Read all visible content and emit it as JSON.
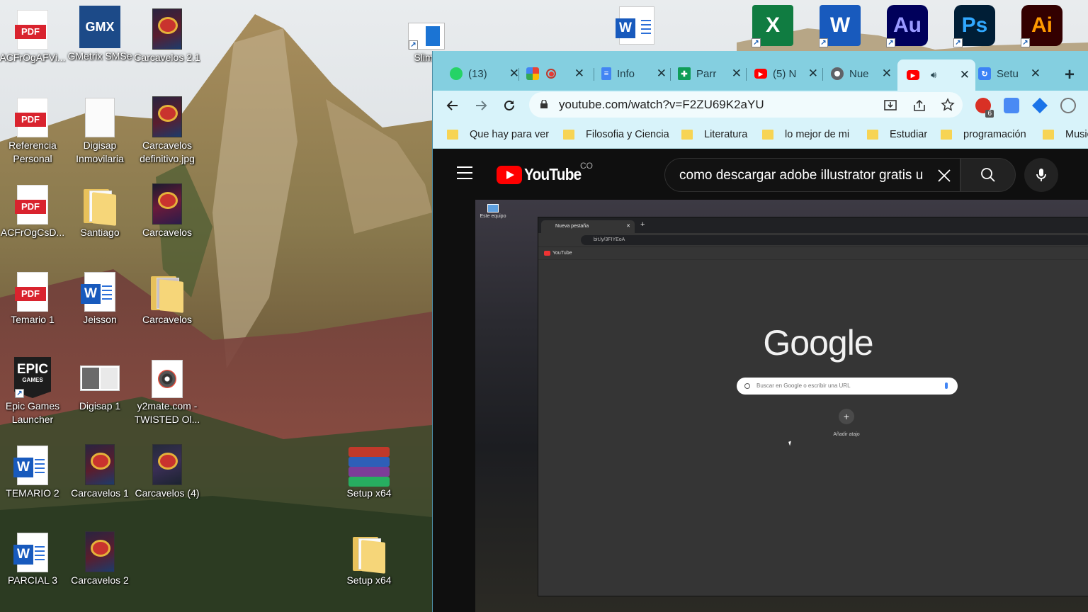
{
  "desktop": {
    "icons": [
      {
        "label": "ACFrOgAFVi...",
        "icon": "pdf-file-icon"
      },
      {
        "label": "GMetrix SMSe",
        "icon": "gmx-app-icon",
        "badge": "GMX"
      },
      {
        "label": "Carcavelos 2.1",
        "icon": "poster-image-icon"
      },
      {
        "label": "Slime",
        "icon": "document-shortcut-icon"
      },
      {
        "label": "Referencia Personal",
        "icon": "pdf-file-icon"
      },
      {
        "label": "Digisap Inmovilaria",
        "icon": "blank-document-icon"
      },
      {
        "label": "Carcavelos definitivo.jpg",
        "icon": "poster-image-icon"
      },
      {
        "label": "ACFrOgCsD...",
        "icon": "pdf-file-icon"
      },
      {
        "label": "Santiago",
        "icon": "folder-icon"
      },
      {
        "label": "Carcavelos",
        "icon": "poster-image-icon"
      },
      {
        "label": "Temario 1",
        "icon": "pdf-file-icon"
      },
      {
        "label": "Jeisson",
        "icon": "word-document-icon"
      },
      {
        "label": "Carcavelos",
        "icon": "folder-icon"
      },
      {
        "label": "Epic Games Launcher",
        "icon": "epic-games-icon",
        "badge": "EPIC",
        "badge_sub": "GAMES"
      },
      {
        "label": "Digisap 1",
        "icon": "image-collection-icon"
      },
      {
        "label": "y2mate.com - TWISTED Ol...",
        "icon": "media-file-icon"
      },
      {
        "label": "TEMARIO 2",
        "icon": "word-document-icon"
      },
      {
        "label": "Carcavelos 1",
        "icon": "poster-image-icon"
      },
      {
        "label": "Carcavelos (4)",
        "icon": "poster-image-icon"
      },
      {
        "label": "Setup x64",
        "icon": "winrar-archive-icon"
      },
      {
        "label": "PARCIAL 3",
        "icon": "word-document-icon"
      },
      {
        "label": "Carcavelos 2",
        "icon": "poster-image-icon"
      },
      {
        "label": "Setup x64",
        "icon": "folder-icon"
      }
    ],
    "pdf_text": "PDF",
    "word_letter": "W",
    "app_tiles": [
      {
        "name": "word-file-icon",
        "letter": "W",
        "color": "#185abd"
      },
      {
        "name": "excel-icon",
        "letter": "X",
        "color": "#107c41"
      },
      {
        "name": "word-icon",
        "letter": "W",
        "color": "#185abd"
      },
      {
        "name": "audition-icon",
        "letter": "Au",
        "color": "#00005b",
        "fg": "#9999ff"
      },
      {
        "name": "photoshop-icon",
        "letter": "Ps",
        "color": "#001e36",
        "fg": "#31a8ff"
      },
      {
        "name": "illustrator-icon",
        "letter": "Ai",
        "color": "#330000",
        "fg": "#ff9a00"
      }
    ]
  },
  "browser": {
    "tabs": [
      {
        "title": "(13)",
        "favicon": "whatsapp-icon",
        "color": "#25d366"
      },
      {
        "title": "",
        "favicon": "google-photos-icon",
        "color": "#fbbc04",
        "extra": "record-icon"
      },
      {
        "title": "Info",
        "favicon": "google-docs-icon",
        "color": "#4285f4"
      },
      {
        "title": "Parr",
        "favicon": "google-sheets-icon",
        "color": "#0f9d58"
      },
      {
        "title": "(5) N",
        "favicon": "youtube-icon",
        "color": "#ff0000"
      },
      {
        "title": "Nue",
        "favicon": "chrome-icon",
        "color": "#5f6368"
      },
      {
        "title": "",
        "favicon": "youtube-icon",
        "color": "#ff0000",
        "extra": "speaker-icon",
        "active": true
      },
      {
        "title": "Setu",
        "favicon": "setup-icon",
        "color": "#3b82f6"
      }
    ],
    "new_tab": "+",
    "url": "youtube.com/watch?v=F2ZU69K2aYU",
    "extension_badge": "6",
    "bookmarks": [
      "Que hay para ver",
      "Filosofia y Ciencia",
      "Literatura",
      "lo mejor de mi",
      "Estudiar",
      "programación",
      "Musica"
    ]
  },
  "youtube": {
    "logo_text": "YouTube",
    "country": "CO",
    "search_query": "como descargar adobe illustrator gratis u",
    "video": {
      "desktop_icon_label": "Este equipo",
      "inner_tab_title": "Nueva pestaña",
      "inner_url": "bit.ly/3FIYEoA",
      "inner_bookmark": "YouTube",
      "google_logo": "Google",
      "google_search_placeholder": "Buscar en Google o escribir una URL",
      "add_shortcut": "Añadir atajo"
    }
  }
}
